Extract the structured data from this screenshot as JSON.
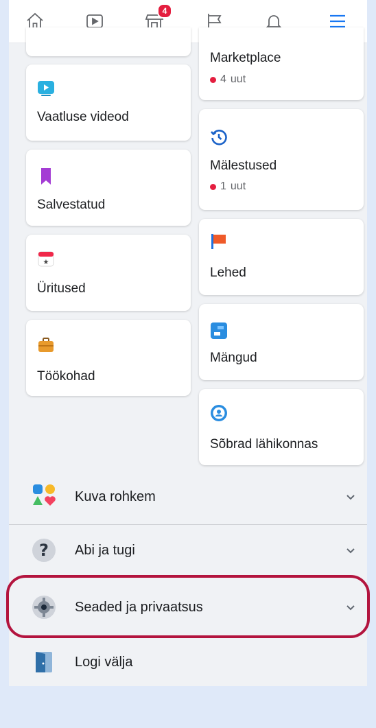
{
  "nav": {
    "items": [
      {
        "name": "home-tab",
        "icon": "home-icon"
      },
      {
        "name": "watch-tab",
        "icon": "play-icon"
      },
      {
        "name": "marketplace-tab",
        "icon": "store-icon",
        "badge": "4"
      },
      {
        "name": "pages-tab",
        "icon": "flag-icon"
      },
      {
        "name": "notifications-tab",
        "icon": "bell-icon"
      },
      {
        "name": "menu-tab",
        "icon": "hamburger-icon",
        "active": true
      }
    ],
    "active_color": "#1877f2"
  },
  "shortcuts": {
    "left": [
      {
        "label": "Vaatluse videod",
        "icon": "video-icon"
      },
      {
        "label": "Salvestatud",
        "icon": "bookmark-icon"
      },
      {
        "label": "Üritused",
        "icon": "calendar-icon"
      },
      {
        "label": "Töökohad",
        "icon": "briefcase-icon"
      }
    ],
    "right": [
      {
        "label": "Marketplace",
        "icon": "store-icon",
        "sub_count": "4",
        "sub_text": "uut"
      },
      {
        "label": "Mälestused",
        "icon": "clock-history-icon",
        "sub_count": "1",
        "sub_text": "uut"
      },
      {
        "label": "Lehed",
        "icon": "flag-icon"
      },
      {
        "label": "Mängud",
        "icon": "game-icon"
      },
      {
        "label": "Sõbrad lähikonnas",
        "icon": "nearby-icon"
      }
    ]
  },
  "menu": {
    "see_more": "Kuva rohkem",
    "help": "Abi ja tugi",
    "settings": "Seaded ja privaatsus",
    "logout": "Logi välja"
  },
  "colors": {
    "highlight_border": "#b3143e",
    "badge": "#e41e3f"
  }
}
